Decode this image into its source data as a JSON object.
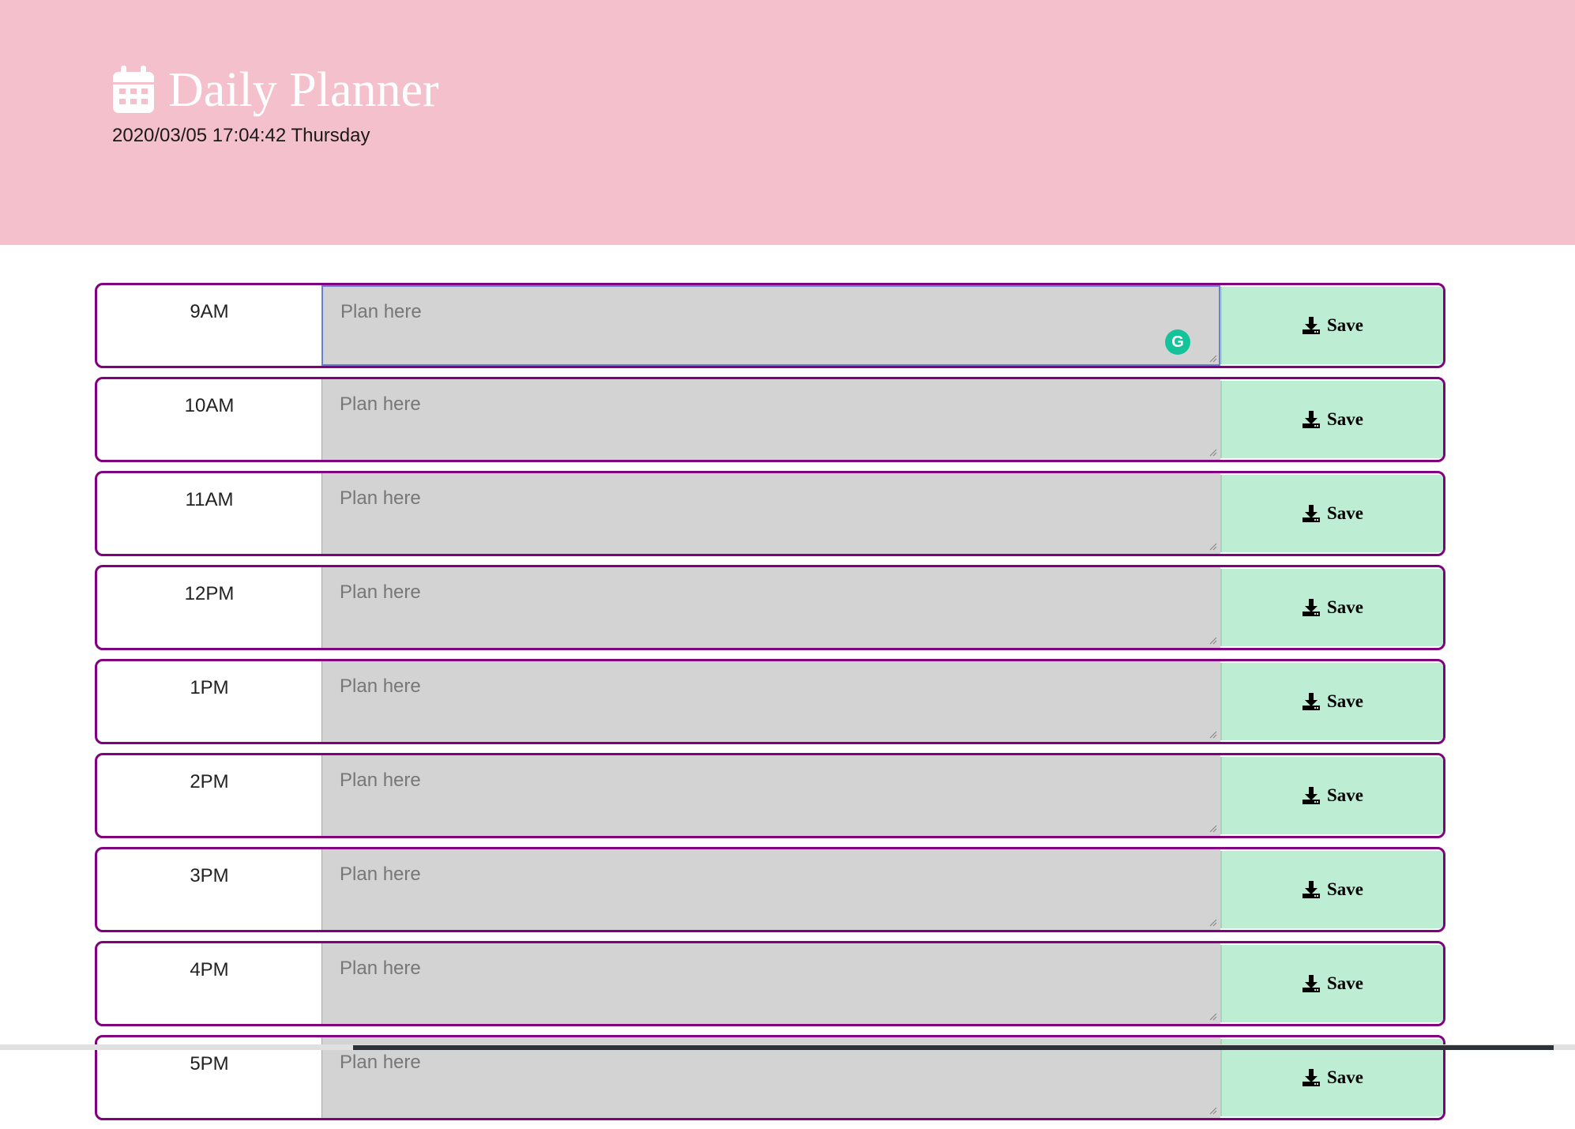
{
  "header": {
    "title": "Daily Planner",
    "datetime": "2020/03/05 17:04:42 Thursday",
    "icon": "calendar-icon",
    "background_color": "#f4c0cb"
  },
  "planner": {
    "placeholder": "Plan here",
    "save_label": "Save",
    "save_icon": "download-icon",
    "row_border_color": "#800080",
    "textarea_color": "#d3d3d3",
    "save_color": "#bdeed3",
    "rows": [
      {
        "hour": "9AM",
        "value": ""
      },
      {
        "hour": "10AM",
        "value": ""
      },
      {
        "hour": "11AM",
        "value": ""
      },
      {
        "hour": "12PM",
        "value": ""
      },
      {
        "hour": "1PM",
        "value": ""
      },
      {
        "hour": "2PM",
        "value": ""
      },
      {
        "hour": "3PM",
        "value": ""
      },
      {
        "hour": "4PM",
        "value": ""
      },
      {
        "hour": "5PM",
        "value": ""
      }
    ]
  },
  "grammarly": {
    "icon": "grammarly-icon",
    "label": "G"
  }
}
